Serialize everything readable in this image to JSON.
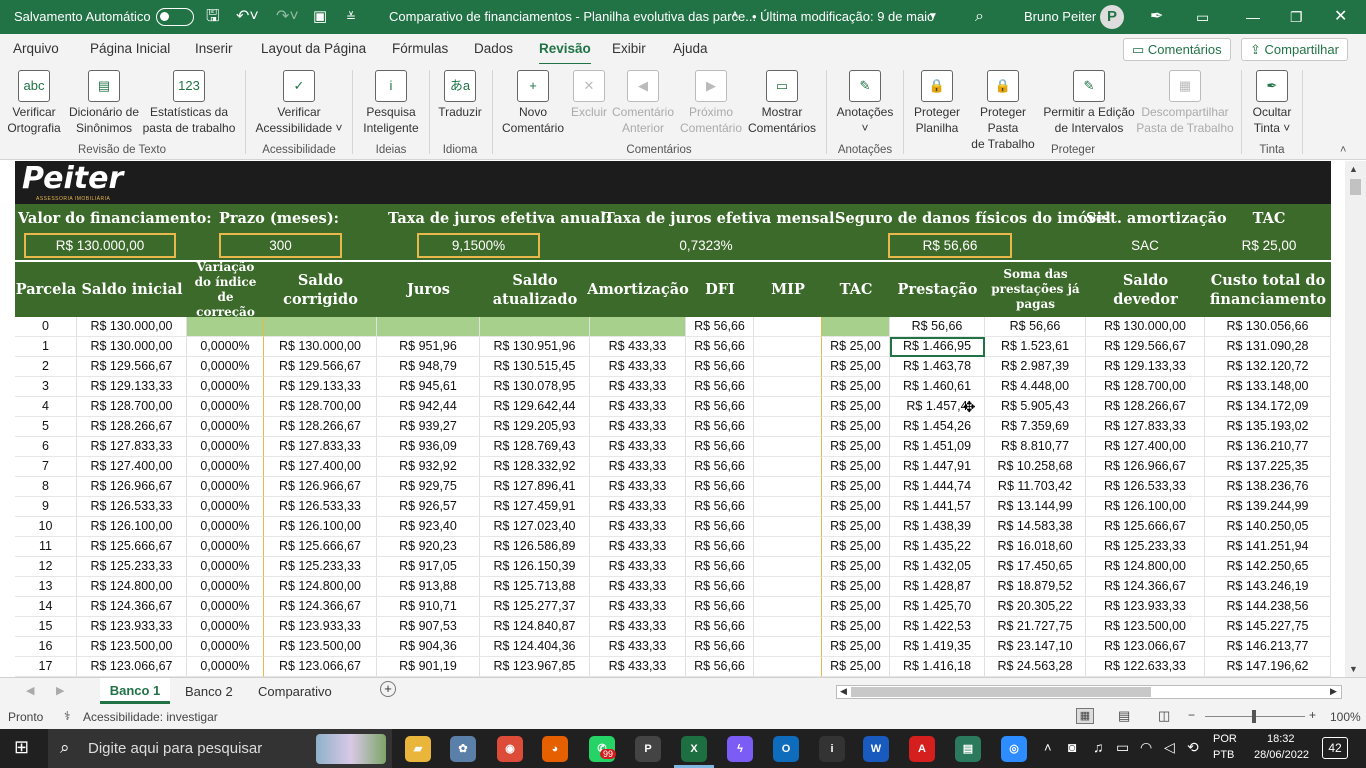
{
  "titlebar": {
    "autosave": "Salvamento Automático",
    "doc_title": "Comparativo de financiamentos - Planilha evolutiva das parce...",
    "mod_info": "• Última modificação: 9 de maio",
    "user": "Bruno Peiter",
    "avatar_letter": "P",
    "accent": "#217346"
  },
  "menu": {
    "tabs": [
      "Arquivo",
      "Página Inicial",
      "Inserir",
      "Layout da Página",
      "Fórmulas",
      "Dados",
      "Revisão",
      "Exibir",
      "Ajuda"
    ],
    "active": "Revisão",
    "comments_btn": "Comentários",
    "share_btn": "Compartilhar"
  },
  "ribbon": {
    "buttons": [
      {
        "l1": "Verificar",
        "l2": "Ortografia",
        "icon": "spell-check-icon",
        "glyph": "abc",
        "enabled": true
      },
      {
        "l1": "Dicionário de",
        "l2": "Sinônimos",
        "icon": "thesaurus-icon",
        "glyph": "▤",
        "enabled": true
      },
      {
        "l1": "Estatísticas da",
        "l2": "pasta de trabalho",
        "icon": "workbook-stats-icon",
        "glyph": "123",
        "enabled": true
      },
      {
        "l1": "Verificar",
        "l2": "Acessibilidade ˅",
        "icon": "accessibility-check-icon",
        "glyph": "✓",
        "enabled": true
      },
      {
        "l1": "Pesquisa",
        "l2": "Inteligente",
        "icon": "smart-lookup-icon",
        "glyph": "i",
        "enabled": true
      },
      {
        "l1": "Traduzir",
        "l2": "",
        "icon": "translate-icon",
        "glyph": "あa",
        "enabled": true
      },
      {
        "l1": "Novo",
        "l2": "Comentário",
        "icon": "new-comment-icon",
        "glyph": "+",
        "enabled": true
      },
      {
        "l1": "Excluir",
        "l2": "",
        "icon": "delete-comment-icon",
        "glyph": "✕",
        "enabled": false
      },
      {
        "l1": "Comentário",
        "l2": "Anterior",
        "icon": "previous-comment-icon",
        "glyph": "◀",
        "enabled": false
      },
      {
        "l1": "Próximo",
        "l2": "Comentário",
        "icon": "next-comment-icon",
        "glyph": "▶",
        "enabled": false
      },
      {
        "l1": "Mostrar",
        "l2": "Comentários",
        "icon": "show-comments-icon",
        "glyph": "▭",
        "enabled": true
      },
      {
        "l1": "Anotações",
        "l2": "˅",
        "icon": "notes-icon",
        "glyph": "✎",
        "enabled": true
      },
      {
        "l1": "Proteger",
        "l2": "Planilha",
        "icon": "protect-sheet-icon",
        "glyph": "🔒",
        "enabled": true
      },
      {
        "l1": "Proteger Pasta",
        "l2": "de Trabalho",
        "icon": "protect-workbook-icon",
        "glyph": "🔒",
        "enabled": true
      },
      {
        "l1": "Permitir a Edição",
        "l2": "de Intervalos",
        "icon": "allow-edit-ranges-icon",
        "glyph": "✎",
        "enabled": true
      },
      {
        "l1": "Descompartilhar",
        "l2": "Pasta de Trabalho",
        "icon": "unshare-workbook-icon",
        "glyph": "▦",
        "enabled": false
      },
      {
        "l1": "Ocultar",
        "l2": "Tinta ˅",
        "icon": "hide-ink-icon",
        "glyph": "✒",
        "enabled": true
      }
    ],
    "groups": [
      "Revisão de Texto",
      "Acessibilidade",
      "Ideias",
      "Idioma",
      "Comentários",
      "Anotações",
      "Proteger",
      "Tinta"
    ]
  },
  "sheet": {
    "logo": "Peiter",
    "logo_sub": "ASSESSORIA IMOBILIÁRIA",
    "params": [
      {
        "label": "Valor do financiamento:",
        "value": "R$ 130.000,00"
      },
      {
        "label": "Prazo (meses):",
        "value": "300"
      },
      {
        "label": "Taxa de juros efetiva anual:",
        "value": "9,1500%"
      },
      {
        "label": "Taxa de juros efetiva mensal:",
        "value": "0,7323%"
      },
      {
        "label": "Seguro de danos físicos do imóvel",
        "value": "R$ 56,66"
      },
      {
        "label": "Sist. amortização",
        "value": "SAC"
      },
      {
        "label": "TAC",
        "value": "R$ 25,00"
      }
    ],
    "headers": [
      "Parcela",
      "Saldo inicial",
      "Variação do índice de correção",
      "Saldo corrigido",
      "Juros",
      "Saldo atualizado",
      "Amortização",
      "DFI",
      "MIP",
      "TAC",
      "Prestação",
      "Soma das prestações já pagas",
      "Saldo devedor",
      "Custo total do financiamento"
    ],
    "rows": [
      [
        "0",
        "R$ 130.000,00",
        "",
        "",
        "",
        "",
        "",
        "R$ 56,66",
        "",
        "",
        "R$ 56,66",
        "R$ 56,66",
        "R$ 130.000,00",
        "R$ 130.056,66"
      ],
      [
        "1",
        "R$ 130.000,00",
        "0,0000%",
        "R$ 130.000,00",
        "R$ 951,96",
        "R$ 130.951,96",
        "R$ 433,33",
        "R$ 56,66",
        "",
        "R$ 25,00",
        "R$ 1.466,95",
        "R$ 1.523,61",
        "R$ 129.566,67",
        "R$ 131.090,28"
      ],
      [
        "2",
        "R$ 129.566,67",
        "0,0000%",
        "R$ 129.566,67",
        "R$ 948,79",
        "R$ 130.515,45",
        "R$ 433,33",
        "R$ 56,66",
        "",
        "R$ 25,00",
        "R$ 1.463,78",
        "R$ 2.987,39",
        "R$ 129.133,33",
        "R$ 132.120,72"
      ],
      [
        "3",
        "R$ 129.133,33",
        "0,0000%",
        "R$ 129.133,33",
        "R$ 945,61",
        "R$ 130.078,95",
        "R$ 433,33",
        "R$ 56,66",
        "",
        "R$ 25,00",
        "R$ 1.460,61",
        "R$ 4.448,00",
        "R$ 128.700,00",
        "R$ 133.148,00"
      ],
      [
        "4",
        "R$ 128.700,00",
        "0,0000%",
        "R$ 128.700,00",
        "R$ 942,44",
        "R$ 129.642,44",
        "R$ 433,33",
        "R$ 56,66",
        "",
        "R$ 25,00",
        "R$ 1.457,4",
        "R$ 5.905,43",
        "R$ 128.266,67",
        "R$ 134.172,09"
      ],
      [
        "5",
        "R$ 128.266,67",
        "0,0000%",
        "R$ 128.266,67",
        "R$ 939,27",
        "R$ 129.205,93",
        "R$ 433,33",
        "R$ 56,66",
        "",
        "R$ 25,00",
        "R$ 1.454,26",
        "R$ 7.359,69",
        "R$ 127.833,33",
        "R$ 135.193,02"
      ],
      [
        "6",
        "R$ 127.833,33",
        "0,0000%",
        "R$ 127.833,33",
        "R$ 936,09",
        "R$ 128.769,43",
        "R$ 433,33",
        "R$ 56,66",
        "",
        "R$ 25,00",
        "R$ 1.451,09",
        "R$ 8.810,77",
        "R$ 127.400,00",
        "R$ 136.210,77"
      ],
      [
        "7",
        "R$ 127.400,00",
        "0,0000%",
        "R$ 127.400,00",
        "R$ 932,92",
        "R$ 128.332,92",
        "R$ 433,33",
        "R$ 56,66",
        "",
        "R$ 25,00",
        "R$ 1.447,91",
        "R$ 10.258,68",
        "R$ 126.966,67",
        "R$ 137.225,35"
      ],
      [
        "8",
        "R$ 126.966,67",
        "0,0000%",
        "R$ 126.966,67",
        "R$ 929,75",
        "R$ 127.896,41",
        "R$ 433,33",
        "R$ 56,66",
        "",
        "R$ 25,00",
        "R$ 1.444,74",
        "R$ 11.703,42",
        "R$ 126.533,33",
        "R$ 138.236,76"
      ],
      [
        "9",
        "R$ 126.533,33",
        "0,0000%",
        "R$ 126.533,33",
        "R$ 926,57",
        "R$ 127.459,91",
        "R$ 433,33",
        "R$ 56,66",
        "",
        "R$ 25,00",
        "R$ 1.441,57",
        "R$ 13.144,99",
        "R$ 126.100,00",
        "R$ 139.244,99"
      ],
      [
        "10",
        "R$ 126.100,00",
        "0,0000%",
        "R$ 126.100,00",
        "R$ 923,40",
        "R$ 127.023,40",
        "R$ 433,33",
        "R$ 56,66",
        "",
        "R$ 25,00",
        "R$ 1.438,39",
        "R$ 14.583,38",
        "R$ 125.666,67",
        "R$ 140.250,05"
      ],
      [
        "11",
        "R$ 125.666,67",
        "0,0000%",
        "R$ 125.666,67",
        "R$ 920,23",
        "R$ 126.586,89",
        "R$ 433,33",
        "R$ 56,66",
        "",
        "R$ 25,00",
        "R$ 1.435,22",
        "R$ 16.018,60",
        "R$ 125.233,33",
        "R$ 141.251,94"
      ],
      [
        "12",
        "R$ 125.233,33",
        "0,0000%",
        "R$ 125.233,33",
        "R$ 917,05",
        "R$ 126.150,39",
        "R$ 433,33",
        "R$ 56,66",
        "",
        "R$ 25,00",
        "R$ 1.432,05",
        "R$ 17.450,65",
        "R$ 124.800,00",
        "R$ 142.250,65"
      ],
      [
        "13",
        "R$ 124.800,00",
        "0,0000%",
        "R$ 124.800,00",
        "R$ 913,88",
        "R$ 125.713,88",
        "R$ 433,33",
        "R$ 56,66",
        "",
        "R$ 25,00",
        "R$ 1.428,87",
        "R$ 18.879,52",
        "R$ 124.366,67",
        "R$ 143.246,19"
      ],
      [
        "14",
        "R$ 124.366,67",
        "0,0000%",
        "R$ 124.366,67",
        "R$ 910,71",
        "R$ 125.277,37",
        "R$ 433,33",
        "R$ 56,66",
        "",
        "R$ 25,00",
        "R$ 1.425,70",
        "R$ 20.305,22",
        "R$ 123.933,33",
        "R$ 144.238,56"
      ],
      [
        "15",
        "R$ 123.933,33",
        "0,0000%",
        "R$ 123.933,33",
        "R$ 907,53",
        "R$ 124.840,87",
        "R$ 433,33",
        "R$ 56,66",
        "",
        "R$ 25,00",
        "R$ 1.422,53",
        "R$ 21.727,75",
        "R$ 123.500,00",
        "R$ 145.227,75"
      ],
      [
        "16",
        "R$ 123.500,00",
        "0,0000%",
        "R$ 123.500,00",
        "R$ 904,36",
        "R$ 124.404,36",
        "R$ 433,33",
        "R$ 56,66",
        "",
        "R$ 25,00",
        "R$ 1.419,35",
        "R$ 23.147,10",
        "R$ 123.066,67",
        "R$ 146.213,77"
      ],
      [
        "17",
        "R$ 123.066,67",
        "0,0000%",
        "R$ 123.066,67",
        "R$ 901,19",
        "R$ 123.967,85",
        "R$ 433,33",
        "R$ 56,66",
        "",
        "R$ 25,00",
        "R$ 1.416,18",
        "R$ 24.563,28",
        "R$ 122.633,33",
        "R$ 147.196,62"
      ]
    ],
    "colors": {
      "dark_band": "#1c1c1c",
      "green_header": "#3c6a2a",
      "light_green": "#a8d08d",
      "gold_border": "#e8b84b"
    }
  },
  "sheet_tabs": {
    "tabs": [
      "Banco 1",
      "Banco 2",
      "Comparativo"
    ],
    "active": "Banco 1"
  },
  "status": {
    "ready": "Pronto",
    "accessibility": "Acessibilidade: investigar",
    "zoom": "100%"
  },
  "taskbar": {
    "search_placeholder": "Digite aqui para pesquisar",
    "lang1": "POR",
    "lang2": "PTB",
    "time": "18:32",
    "date": "28/06/2022",
    "notif_count": "42",
    "whatsapp_badge": "99"
  }
}
